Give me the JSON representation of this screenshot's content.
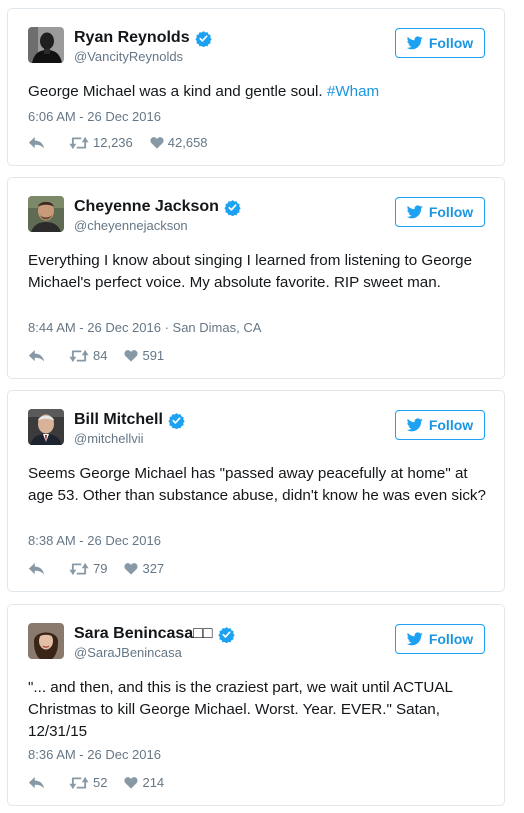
{
  "tweets": [
    {
      "name": "Ryan Reynolds",
      "handle": "@VancityReynolds",
      "text": "George Michael was a kind and gentle soul. ",
      "hashtag": "#Wham",
      "meta": "6:06 AM - 26 Dec 2016",
      "retweets": "12,236",
      "likes": "42,658",
      "follow_label": "Follow"
    },
    {
      "name": "Cheyenne Jackson",
      "handle": "@cheyennejackson",
      "text": "Everything I know about singing I learned from listening to George Michael's perfect voice. My absolute favorite. RIP sweet man.",
      "meta": "8:44 AM - 26 Dec 2016 · San Dimas, CA",
      "retweets": "84",
      "likes": "591",
      "follow_label": "Follow"
    },
    {
      "name": "Bill Mitchell",
      "handle": "@mitchellvii",
      "text": "Seems George Michael has \"passed away peacefully at home\" at age 53. Other than substance abuse, didn't know he was even sick?",
      "meta": "8:38 AM - 26 Dec 2016",
      "retweets": "79",
      "likes": "327",
      "follow_label": "Follow"
    },
    {
      "name": "Sara Benincasa□□",
      "handle": "@SaraJBenincasa",
      "text": "\"... and then, and this is the craziest part, we wait until ACTUAL Christmas to kill George Michael. Worst. Year. EVER.\" Satan, 12/31/15",
      "meta": "8:36 AM - 26 Dec 2016",
      "retweets": "52",
      "likes": "214",
      "follow_label": "Follow"
    }
  ],
  "icons": {
    "verified": "verified-badge-icon",
    "follow": "twitter-bird-icon",
    "reply": "reply-arrow-icon",
    "retweet": "retweet-icon",
    "like": "heart-icon"
  },
  "colors": {
    "brand_blue": "#1da1f2",
    "link_blue": "#1b95e0",
    "secondary_text": "#657786",
    "border": "#e1e8ed"
  }
}
